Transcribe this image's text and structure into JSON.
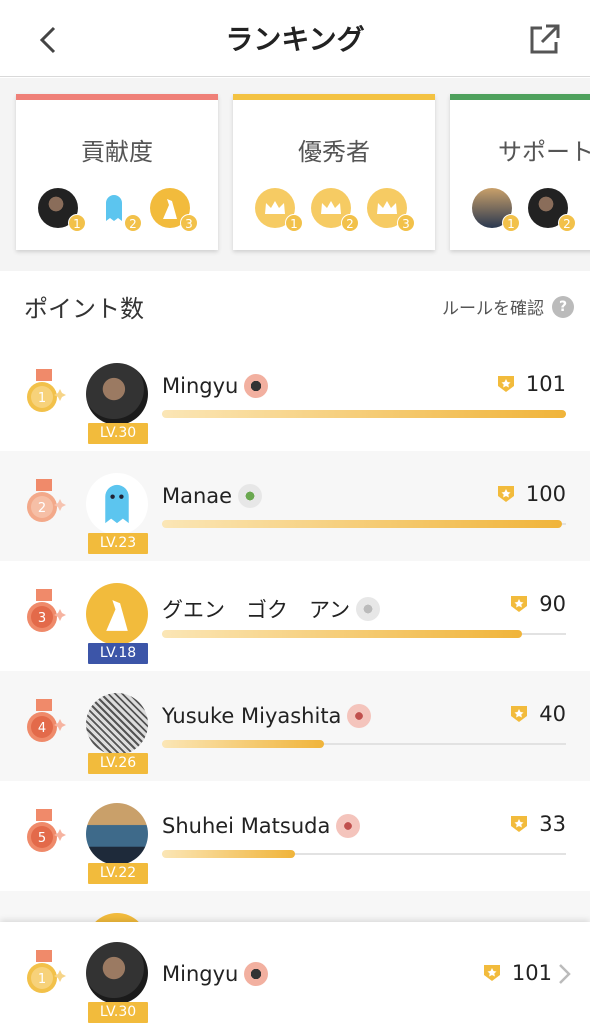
{
  "header": {
    "title": "ランキング",
    "back_icon": "chevron-left-icon",
    "share_icon": "share-external-icon"
  },
  "cards": [
    {
      "title": "貢献度",
      "accent": "#ef8078",
      "ranks": [
        "1",
        "2",
        "3"
      ]
    },
    {
      "title": "優秀者",
      "accent": "#f3c242",
      "ranks": [
        "1",
        "2",
        "3"
      ]
    },
    {
      "title": "サポート",
      "accent": "#4ea05c",
      "ranks": [
        "1",
        "2"
      ]
    }
  ],
  "section": {
    "title": "ポイント数",
    "rules_link": "ルールを確認",
    "rules_icon": "?"
  },
  "rows": [
    {
      "rank": "1",
      "name": "Mingyu",
      "level": "LV.30",
      "score": "101",
      "progress": 1.0,
      "medal_color": "#f2c14a",
      "badge_color": "#f2b0a0"
    },
    {
      "rank": "2",
      "name": "Manae",
      "level": "LV.23",
      "score": "100",
      "progress": 0.99,
      "medal_color": "#f3a98a",
      "badge_color": "#e7e7e7"
    },
    {
      "rank": "3",
      "name": "グエン　ゴク　アン",
      "level": "LV.18",
      "score": "90",
      "progress": 0.89,
      "medal_color": "#ef8a6a",
      "badge_color": "#e7e7e7"
    },
    {
      "rank": "4",
      "name": "Yusuke Miyashita",
      "level": "LV.26",
      "score": "40",
      "progress": 0.4,
      "medal_color": "#ef8a6a",
      "badge_color": "#f4c4bc"
    },
    {
      "rank": "5",
      "name": "Shuhei Matsuda",
      "level": "LV.22",
      "score": "33",
      "progress": 0.33,
      "medal_color": "#ef8a6a",
      "badge_color": "#f4c4bc"
    }
  ],
  "me": {
    "rank": "1",
    "name": "Mingyu",
    "level": "LV.30",
    "score": "101"
  },
  "colors": {
    "gold": "#f2bb3c",
    "blue_level": "#3c55a8",
    "bar_end": "#f0b43a"
  }
}
